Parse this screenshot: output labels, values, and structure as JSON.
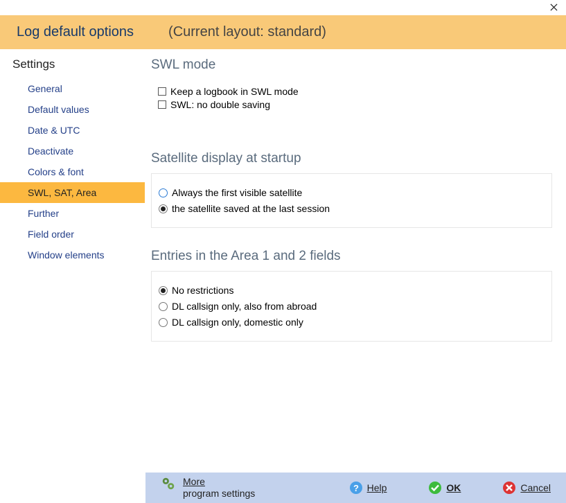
{
  "titlebar": {
    "close_icon": "close"
  },
  "banner": {
    "title": "Log default options",
    "subtitle": "(Current layout: standard)"
  },
  "sidebar": {
    "title": "Settings",
    "items": [
      {
        "label": "General"
      },
      {
        "label": "Default values"
      },
      {
        "label": "Date & UTC"
      },
      {
        "label": "Deactivate"
      },
      {
        "label": "Colors & font"
      },
      {
        "label": "SWL, SAT, Area",
        "selected": true
      },
      {
        "label": "Further"
      },
      {
        "label": "Field order"
      },
      {
        "label": "Window elements"
      }
    ]
  },
  "sections": {
    "swl": {
      "title": "SWL mode",
      "options": [
        {
          "label": "Keep a logbook in SWL mode",
          "checked": false
        },
        {
          "label": "SWL: no double saving",
          "checked": false
        }
      ]
    },
    "sat": {
      "title": "Satellite display at startup",
      "options": [
        {
          "label": "Always the first visible satellite",
          "selected": false
        },
        {
          "label": "the satellite saved at the last session",
          "selected": true
        }
      ]
    },
    "area": {
      "title": "Entries in the Area 1 and 2 fields",
      "options": [
        {
          "label": "No restrictions",
          "selected": true
        },
        {
          "label": "DL callsign only, also from abroad",
          "selected": false
        },
        {
          "label": "DL callsign only, domestic only",
          "selected": false
        }
      ]
    }
  },
  "footer": {
    "more": {
      "line1": "More",
      "line2": "program settings"
    },
    "help": "Help",
    "ok": "OK",
    "cancel": "Cancel"
  }
}
